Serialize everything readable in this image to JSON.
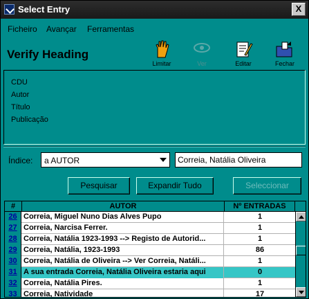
{
  "window": {
    "title": "Select Entry",
    "close_label": "X"
  },
  "menu": [
    "Ficheiro",
    "Avançar",
    "Ferramentas"
  ],
  "heading": "Verify Heading",
  "toolbar": {
    "limitar": "Limitar",
    "ver": "Ver",
    "editar": "Editar",
    "fechar": "Fechar"
  },
  "info_fields": [
    "CDU",
    "Autor",
    "Título",
    "Publicação"
  ],
  "index": {
    "label": "Índice:",
    "selected": "a AUTOR",
    "search_value": "Correia, Natália Oliveira"
  },
  "buttons": {
    "pesquisar": "Pesquisar",
    "expandir": "Expandir Tudo",
    "seleccionar": "Seleccionar"
  },
  "table": {
    "headers": [
      "#",
      "AUTOR",
      "Nº ENTRADAS"
    ],
    "rows": [
      {
        "num": "26",
        "name": "Correia, Miguel Nuno Dias Alves Pupo",
        "count": "1"
      },
      {
        "num": "27",
        "name": "Correia, Narcisa Ferrer.",
        "count": "1"
      },
      {
        "num": "28",
        "name": "Correia, Natália 1923-1993 --> Registo de Autorid...",
        "count": "1"
      },
      {
        "num": "29",
        "name": "Correia, Natália, 1923-1993",
        "count": "86"
      },
      {
        "num": "30",
        "name": "Correia, Natália de Oliveira --> Ver Correia, Natáli...",
        "count": "1"
      },
      {
        "num": "31",
        "name": "A sua entrada Correia, Natália Oliveira estaria aqui",
        "count": "0"
      },
      {
        "num": "32",
        "name": "Correia, Natália Pires.",
        "count": "1"
      },
      {
        "num": "33",
        "name": "Correia, Natividade",
        "count": "17"
      }
    ]
  },
  "colors": {
    "background": "#008c8c",
    "selected_row": "#36c6c6",
    "link_number": "#0000a0"
  }
}
